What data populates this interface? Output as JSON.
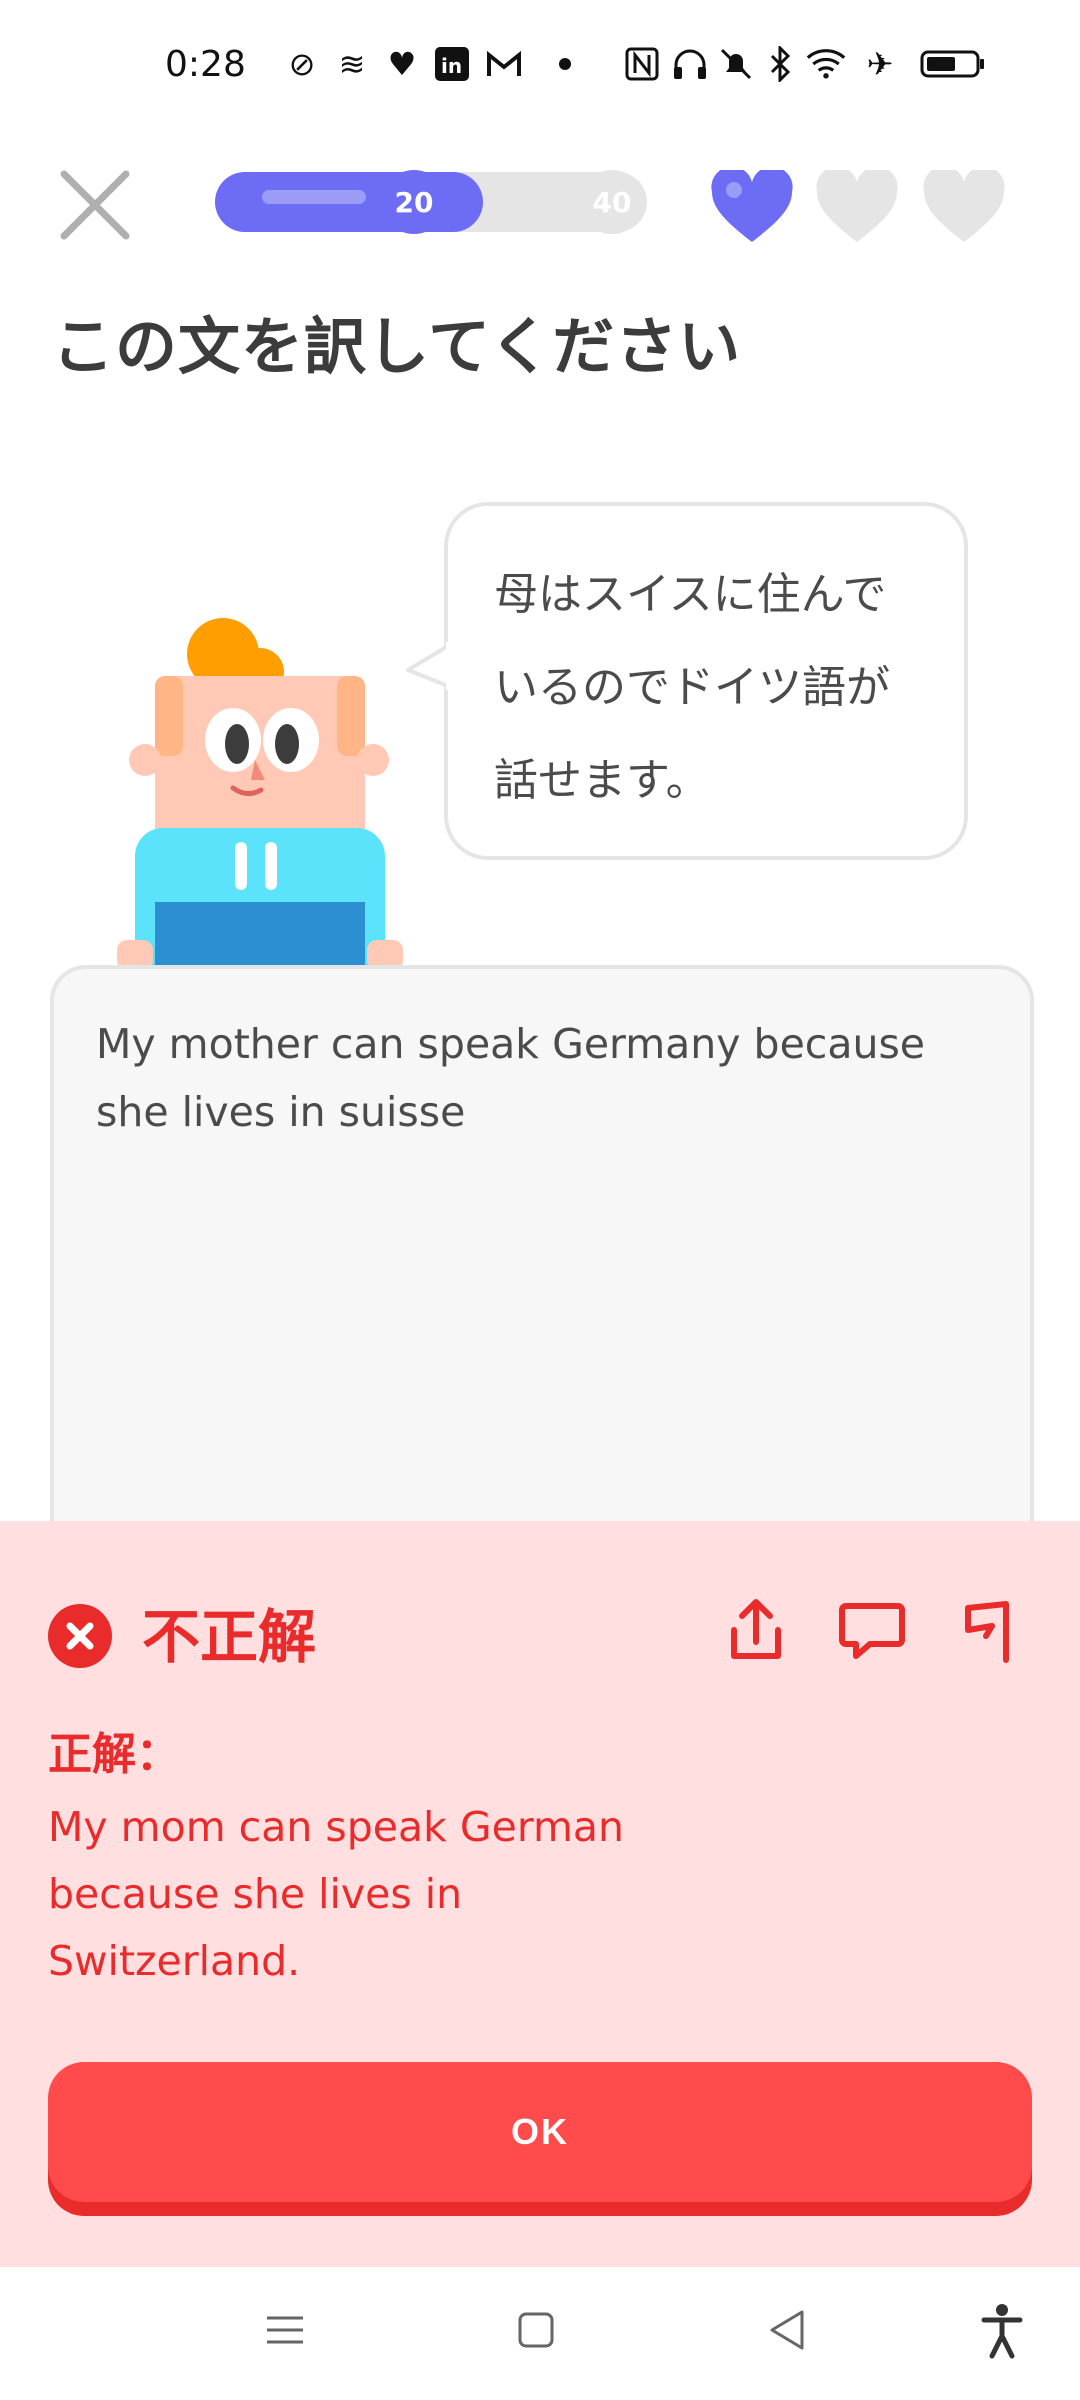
{
  "status_bar": {
    "time": "0:28",
    "left_icons": [
      "sync-off-icon",
      "app-icon",
      "heart-app-icon",
      "linkedin-icon",
      "gmail-icon",
      "dot-icon"
    ],
    "right_icons": [
      "nfc-icon",
      "headphones-icon",
      "bell-off-icon",
      "bluetooth-icon",
      "wifi-icon",
      "airplane-icon",
      "battery-icon"
    ]
  },
  "header": {
    "progress": {
      "value": 0.62,
      "milestones": [
        "20",
        "40"
      ]
    },
    "hearts": {
      "filled": 1,
      "total": 3
    }
  },
  "page_title": "この文を訳してください",
  "prompt": {
    "lines": [
      "母はスイスに住んで",
      "いるのでドイツ語が",
      "話せます。"
    ]
  },
  "answer": {
    "lines": [
      "My mother can speak Germany because",
      "she lives in suisse"
    ]
  },
  "result": {
    "status": "不正解",
    "correct_label": "正解：",
    "correct_lines": [
      "My mom can speak German",
      "because she lives in",
      "Switzerland."
    ],
    "ok_label": "OK"
  },
  "colors": {
    "accent_blue": "#6c6cf5",
    "error_red": "#ea2b2b",
    "ok_button": "#ff4b4b",
    "panel_bg": "#ffdfe0"
  }
}
